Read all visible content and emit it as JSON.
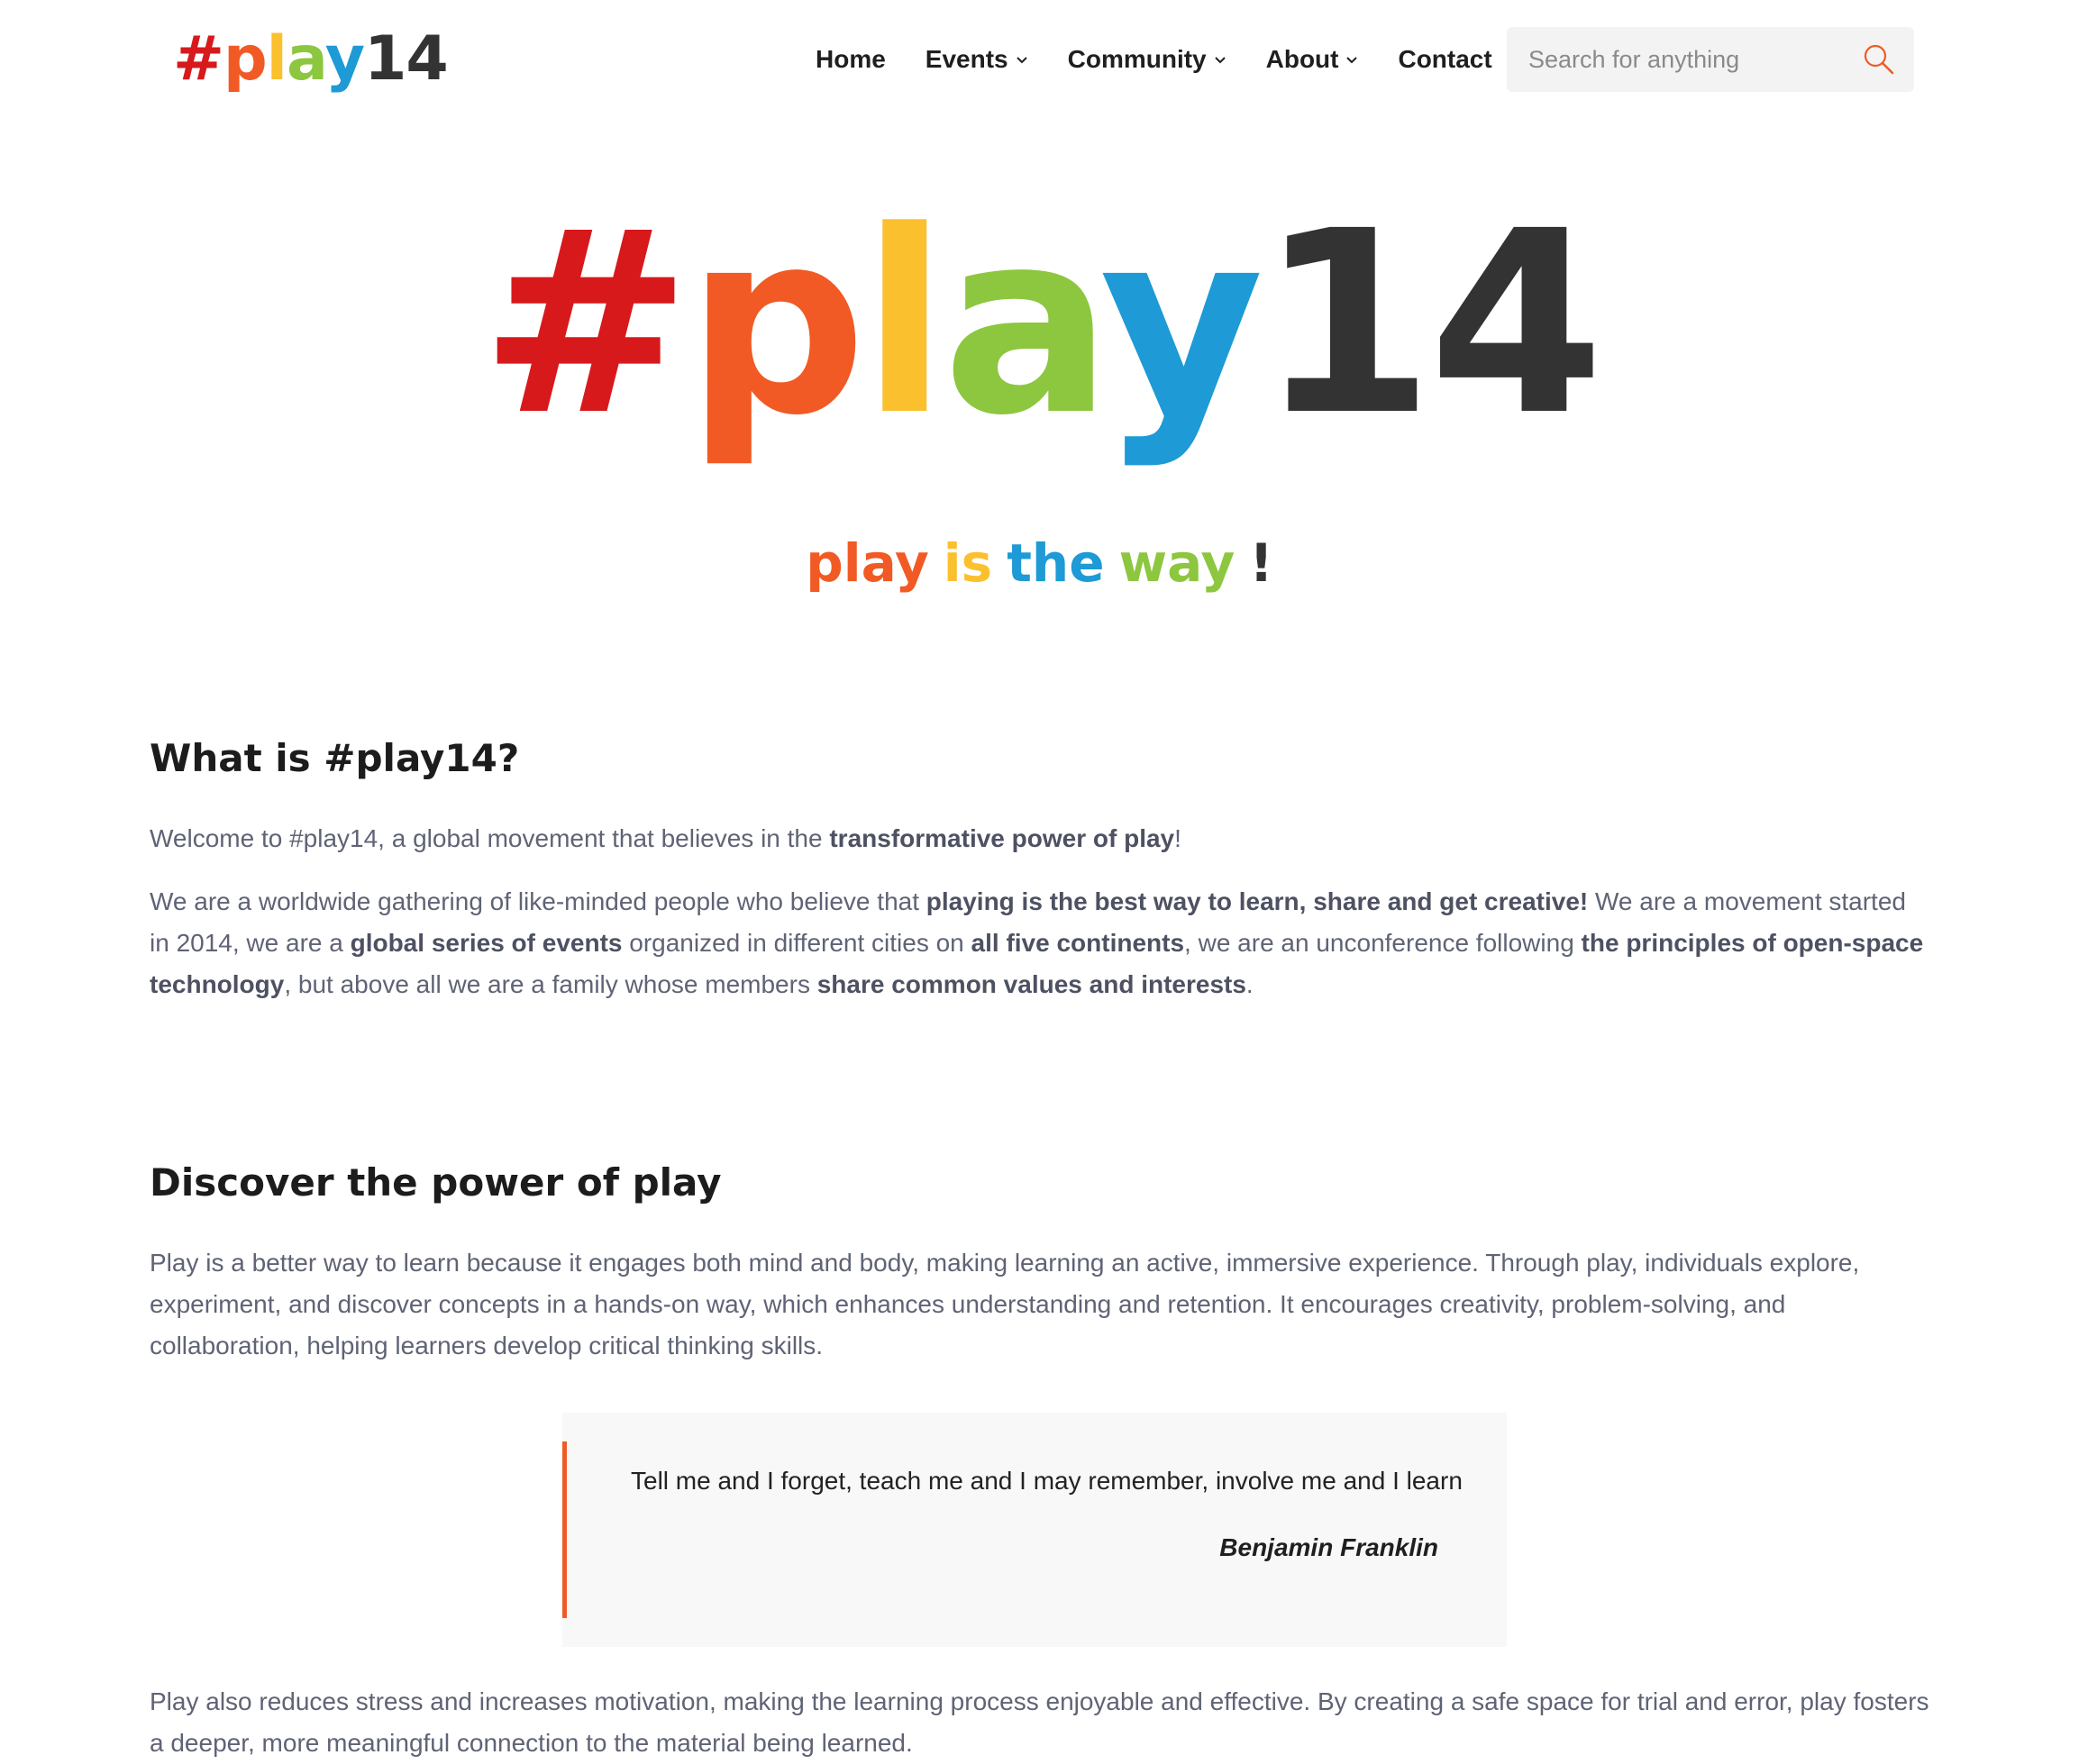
{
  "brand": {
    "logo_parts": [
      {
        "text": "#",
        "color": "#d7191c"
      },
      {
        "text": "p",
        "color": "#f15a24"
      },
      {
        "text": "l",
        "color": "#fbc02d"
      },
      {
        "text": "a",
        "color": "#8dc63f"
      },
      {
        "text": "y",
        "color": "#1e9ad6"
      },
      {
        "text": "14",
        "color": "#333333"
      }
    ]
  },
  "nav": {
    "items": [
      {
        "label": "Home",
        "has_dropdown": false
      },
      {
        "label": "Events",
        "has_dropdown": true
      },
      {
        "label": "Community",
        "has_dropdown": true
      },
      {
        "label": "About",
        "has_dropdown": true
      },
      {
        "label": "Contact",
        "has_dropdown": false
      }
    ],
    "search": {
      "placeholder": "Search for anything",
      "value": "",
      "icon": "search-icon",
      "icon_color": "#f15a24"
    }
  },
  "hero": {
    "tagline": [
      {
        "text": "play",
        "color": "#f15a24"
      },
      {
        "text": "is",
        "color": "#fbc02d"
      },
      {
        "text": "the",
        "color": "#1e9ad6"
      },
      {
        "text": "way",
        "color": "#8dc63f"
      },
      {
        "text": "!",
        "color": "#333333"
      }
    ]
  },
  "section1": {
    "title": "What is #play14?",
    "p1": [
      {
        "text": "Welcome to #play14, a global movement that believes in the ",
        "bold": false
      },
      {
        "text": "transformative power of play",
        "bold": true
      },
      {
        "text": "!",
        "bold": false
      }
    ],
    "p2": [
      {
        "text": "We are a worldwide gathering of like-minded people who believe that ",
        "bold": false
      },
      {
        "text": "playing is the best way to learn, share and get creative!",
        "bold": true
      },
      {
        "text": " We are a movement started in 2014, we are a ",
        "bold": false
      },
      {
        "text": "global series of events",
        "bold": true
      },
      {
        "text": " organized in different cities on ",
        "bold": false
      },
      {
        "text": "all five continents",
        "bold": true
      },
      {
        "text": ", we are an unconference following ",
        "bold": false
      },
      {
        "text": "the principles of open-space technology",
        "bold": true
      },
      {
        "text": ", but above all we are a family whose members ",
        "bold": false
      },
      {
        "text": "share common values and interests",
        "bold": true
      },
      {
        "text": ".",
        "bold": false
      }
    ]
  },
  "section2": {
    "title": "Discover the power of play",
    "p1": "Play is a better way to learn because it engages both mind and body, making learning an active, immersive experience. Through play, individuals explore, experiment, and discover concepts in a hands-on way, which enhances understanding and retention. It encourages creativity, problem-solving, and collaboration, helping learners develop critical thinking skills.",
    "quote": {
      "text": "Tell me and I forget, teach me and I may remember, involve me and I learn",
      "author": "Benjamin Franklin",
      "accent_color": "#f05a28"
    },
    "p2": "Play also reduces stress and increases motivation, making the learning process enjoyable and effective. By creating a safe space for trial and error, play fosters a deeper, more meaningful connection to the material being learned."
  }
}
